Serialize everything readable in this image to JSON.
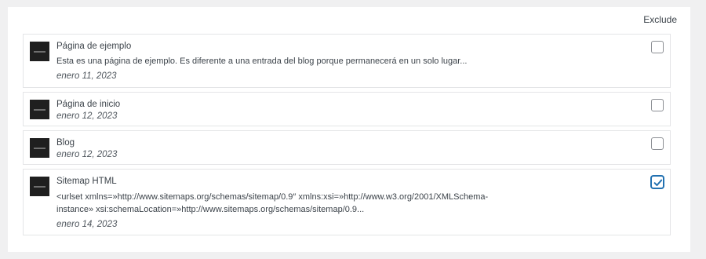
{
  "header": {
    "exclude_label": "Exclude"
  },
  "items": [
    {
      "title": "Página de ejemplo",
      "excerpt": "Esta es una página de ejemplo. Es diferente a una entrada del blog porque permanecerá en un solo lugar...",
      "date": "enero 11, 2023",
      "excluded": false
    },
    {
      "title": "Página de inicio",
      "excerpt": "",
      "date": "enero 12, 2023",
      "excluded": false
    },
    {
      "title": "Blog",
      "excerpt": "",
      "date": "enero 12, 2023",
      "excluded": false
    },
    {
      "title": "Sitemap HTML",
      "excerpt": "<urlset xmlns=»http://www.sitemaps.org/schemas/sitemap/0.9″ xmlns:xsi=»http://www.w3.org/2001/XMLSchema-instance» xsi:schemaLocation=»http://www.sitemaps.org/schemas/sitemap/0.9...",
      "date": "enero 14, 2023",
      "excluded": true
    }
  ],
  "colors": {
    "accent": "#2271b1",
    "thumbnail": "#1f1f1f"
  }
}
